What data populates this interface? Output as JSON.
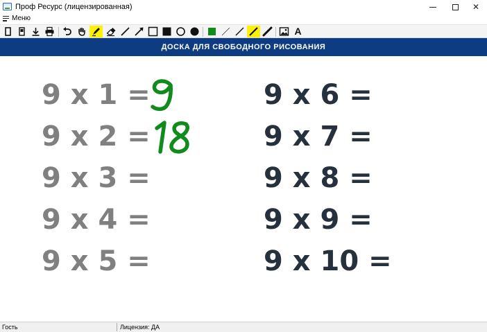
{
  "window": {
    "title": "Проф Ресурс (лицензированная)",
    "controls": {
      "minimize": "minimize",
      "maximize": "maximize",
      "close": "✕"
    }
  },
  "menu": {
    "label": "Меню"
  },
  "toolbar": {
    "highlight_color": "#fff200",
    "tools": [
      "new-page-icon",
      "tablet-icon",
      "download-icon",
      "print-icon",
      "undo-icon",
      "hand-icon",
      "highlighter-icon",
      "eraser-icon",
      "line-icon",
      "arrow-icon",
      "rectangle-outline-icon",
      "rectangle-filled-icon",
      "circle-outline-icon",
      "circle-filled-icon",
      "color-swatch-green-icon",
      "thin-line-icon",
      "medium-line-icon",
      "thick-line-icon",
      "marker-icon",
      "image-icon",
      "text-icon"
    ],
    "text_tool_label": "A",
    "active_color": "#118c1c"
  },
  "board": {
    "title": "ДОСКА ДЛЯ СВОБОДНОГО РИСОВАНИЯ",
    "header_color": "#0d3c82",
    "left_column": [
      "9 x 1 =",
      "9 x 2 =",
      "9 x 3 =",
      "9 x 4 =",
      "9 x 5 ="
    ],
    "right_column": [
      "9 x 6 =",
      "9 x 7 =",
      "9 x 8 =",
      "9 x 9 =",
      "9 x 10 ="
    ],
    "handwritten_answers": [
      "9",
      "18"
    ],
    "colors": {
      "left": "#808080",
      "right": "#26313d",
      "ink": "#118c1c"
    }
  },
  "status": {
    "user": "Гость",
    "license": "Лицензия: ДА"
  }
}
